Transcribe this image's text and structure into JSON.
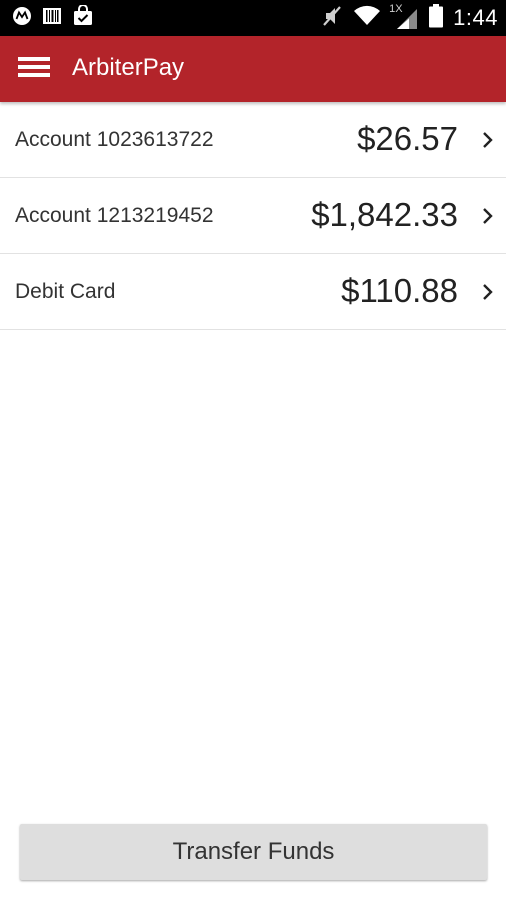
{
  "status_bar": {
    "time": "1:44",
    "left_icons": [
      "motorola-icon",
      "barcode-icon",
      "shopping-bag-icon"
    ],
    "right_icons": [
      "mute-icon",
      "wifi-icon",
      "signal-icon",
      "battery-icon"
    ],
    "network_label": "1X"
  },
  "app_bar": {
    "title": "ArbiterPay",
    "menu_icon": "hamburger-menu-icon",
    "color": "#b3242a"
  },
  "accounts": [
    {
      "name": "Account 1023613722",
      "balance": "$26.57"
    },
    {
      "name": "Account 1213219452",
      "balance": "$1,842.33"
    },
    {
      "name": "Debit Card",
      "balance": "$110.88"
    }
  ],
  "footer": {
    "transfer_label": "Transfer Funds"
  }
}
